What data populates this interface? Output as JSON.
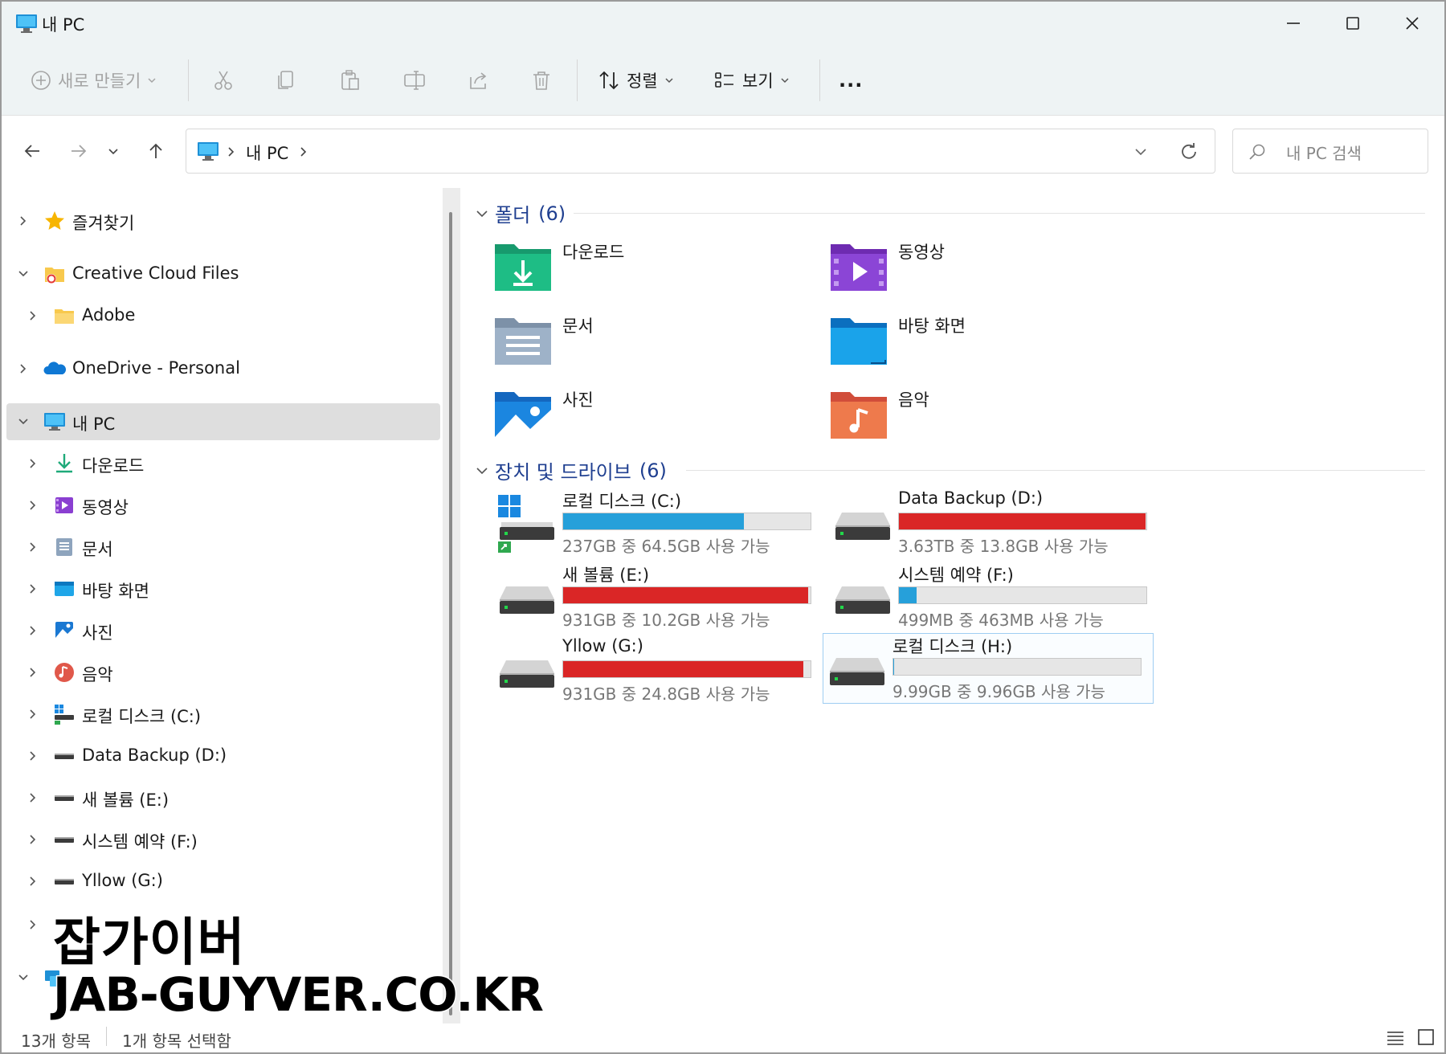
{
  "window": {
    "title": "내 PC"
  },
  "toolbar": {
    "new_label": "새로 만들기",
    "sort_label": "정렬",
    "view_label": "보기",
    "more_label": "..."
  },
  "address": {
    "path": [
      "내 PC"
    ]
  },
  "search": {
    "placeholder": "내 PC 검색"
  },
  "sidebar": {
    "items": [
      {
        "label": "즐겨찾기",
        "icon": "star-icon"
      },
      {
        "label": "Creative Cloud Files",
        "icon": "creative-cloud-folder-icon"
      },
      {
        "label": "Adobe",
        "icon": "folder-icon"
      },
      {
        "label": "OneDrive - Personal",
        "icon": "onedrive-cloud-icon"
      },
      {
        "label": "내 PC",
        "icon": "pc-icon"
      },
      {
        "label": "다운로드",
        "icon": "download-icon"
      },
      {
        "label": "동영상",
        "icon": "video-icon"
      },
      {
        "label": "문서",
        "icon": "document-icon"
      },
      {
        "label": "바탕 화면",
        "icon": "desktop-icon"
      },
      {
        "label": "사진",
        "icon": "picture-icon"
      },
      {
        "label": "음악",
        "icon": "music-icon"
      },
      {
        "label": "로컬 디스크 (C:)",
        "icon": "windows-drive-icon"
      },
      {
        "label": "Data Backup (D:)",
        "icon": "drive-icon"
      },
      {
        "label": "새 볼륨 (E:)",
        "icon": "drive-icon"
      },
      {
        "label": "시스템 예약 (F:)",
        "icon": "drive-icon"
      },
      {
        "label": "Yllow (G:)",
        "icon": "drive-icon"
      }
    ]
  },
  "main": {
    "folders_title": "폴더",
    "folders_count": "(6)",
    "folders": [
      {
        "name": "다운로드",
        "icon": "download-folder-icon"
      },
      {
        "name": "동영상",
        "icon": "video-folder-icon"
      },
      {
        "name": "문서",
        "icon": "document-folder-icon"
      },
      {
        "name": "바탕 화면",
        "icon": "desktop-folder-icon"
      },
      {
        "name": "사진",
        "icon": "picture-folder-icon"
      },
      {
        "name": "음악",
        "icon": "music-folder-icon"
      }
    ],
    "drives_title": "장치 및 드라이브",
    "drives_count": "(6)",
    "drives": [
      {
        "name": "로컬 디스크 (C:)",
        "info": "237GB 중 64.5GB 사용 가능",
        "used_fraction": 0.73,
        "color": "#26a0da"
      },
      {
        "name": "Data Backup (D:)",
        "info": "3.63TB 중 13.8GB 사용 가능",
        "used_fraction": 0.996,
        "color": "#da2626"
      },
      {
        "name": "새 볼륨 (E:)",
        "info": "931GB 중 10.2GB 사용 가능",
        "used_fraction": 0.99,
        "color": "#da2626"
      },
      {
        "name": "시스템 예약 (F:)",
        "info": "499MB 중 463MB 사용 가능",
        "used_fraction": 0.07,
        "color": "#26a0da"
      },
      {
        "name": "Yllow (G:)",
        "info": "931GB 중 24.8GB 사용 가능",
        "used_fraction": 0.97,
        "color": "#da2626"
      },
      {
        "name": "로컬 디스크 (H:)",
        "info": "9.99GB 중 9.96GB 사용 가능",
        "used_fraction": 0.003,
        "color": "#26a0da"
      }
    ]
  },
  "status": {
    "items": "13개 항목",
    "selected": "1개 항목 선택함"
  },
  "watermark": {
    "line1": "잡가이버",
    "line2": "JAB-GUYVER.CO.KR"
  }
}
